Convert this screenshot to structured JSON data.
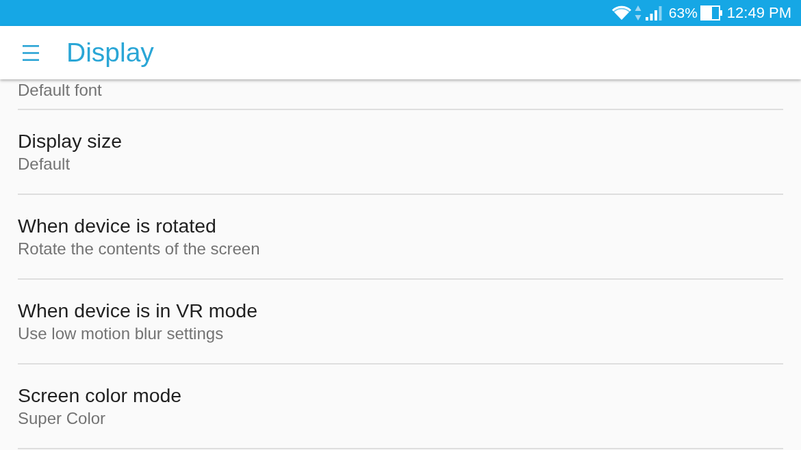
{
  "status_bar": {
    "battery": "63%",
    "time": "12:49 PM"
  },
  "app_bar": {
    "title": "Display"
  },
  "settings": [
    {
      "summary": "Default font"
    },
    {
      "title": "Display size",
      "summary": "Default"
    },
    {
      "title": "When device is rotated",
      "summary": "Rotate the contents of the screen"
    },
    {
      "title": "When device is in VR mode",
      "summary": "Use low motion blur settings"
    },
    {
      "title": "Screen color mode",
      "summary": "Super Color"
    }
  ]
}
